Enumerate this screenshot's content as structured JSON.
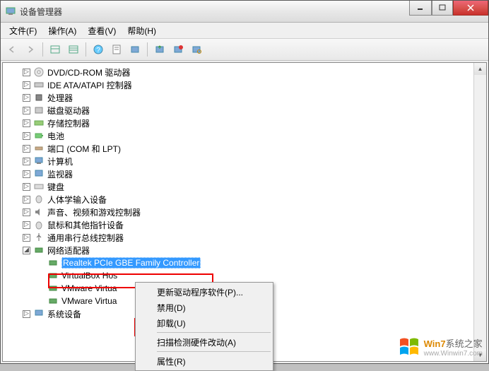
{
  "window": {
    "title": "设备管理器"
  },
  "menu": {
    "file": "文件(F)",
    "action": "操作(A)",
    "view": "查看(V)",
    "help": "帮助(H)"
  },
  "tree": {
    "items": [
      {
        "label": "DVD/CD-ROM 驱动器",
        "icon": "cd"
      },
      {
        "label": "IDE ATA/ATAPI 控制器",
        "icon": "ide"
      },
      {
        "label": "处理器",
        "icon": "cpu"
      },
      {
        "label": "磁盘驱动器",
        "icon": "disk"
      },
      {
        "label": "存储控制器",
        "icon": "storage"
      },
      {
        "label": "电池",
        "icon": "battery"
      },
      {
        "label": "端口 (COM 和 LPT)",
        "icon": "port"
      },
      {
        "label": "计算机",
        "icon": "computer"
      },
      {
        "label": "监视器",
        "icon": "monitor"
      },
      {
        "label": "键盘",
        "icon": "keyboard"
      },
      {
        "label": "人体学输入设备",
        "icon": "hid"
      },
      {
        "label": "声音、视频和游戏控制器",
        "icon": "sound"
      },
      {
        "label": "鼠标和其他指针设备",
        "icon": "mouse"
      },
      {
        "label": "通用串行总线控制器",
        "icon": "usb"
      }
    ],
    "network": {
      "label": "网络适配器",
      "children": [
        {
          "label": "Realtek PCIe GBE Family Controller",
          "selected": true
        },
        {
          "label": "VirtualBox Hos"
        },
        {
          "label": "VMware Virtua"
        },
        {
          "label": "VMware Virtua"
        }
      ]
    },
    "system": {
      "label": "系统设备"
    }
  },
  "context_menu": {
    "update": "更新驱动程序软件(P)...",
    "disable": "禁用(D)",
    "uninstall": "卸载(U)",
    "scan": "扫描检测硬件改动(A)",
    "properties": "属性(R)"
  },
  "watermark": {
    "brand": "Win7",
    "text": "系统之家",
    "url": "www.Winwin7.com"
  }
}
